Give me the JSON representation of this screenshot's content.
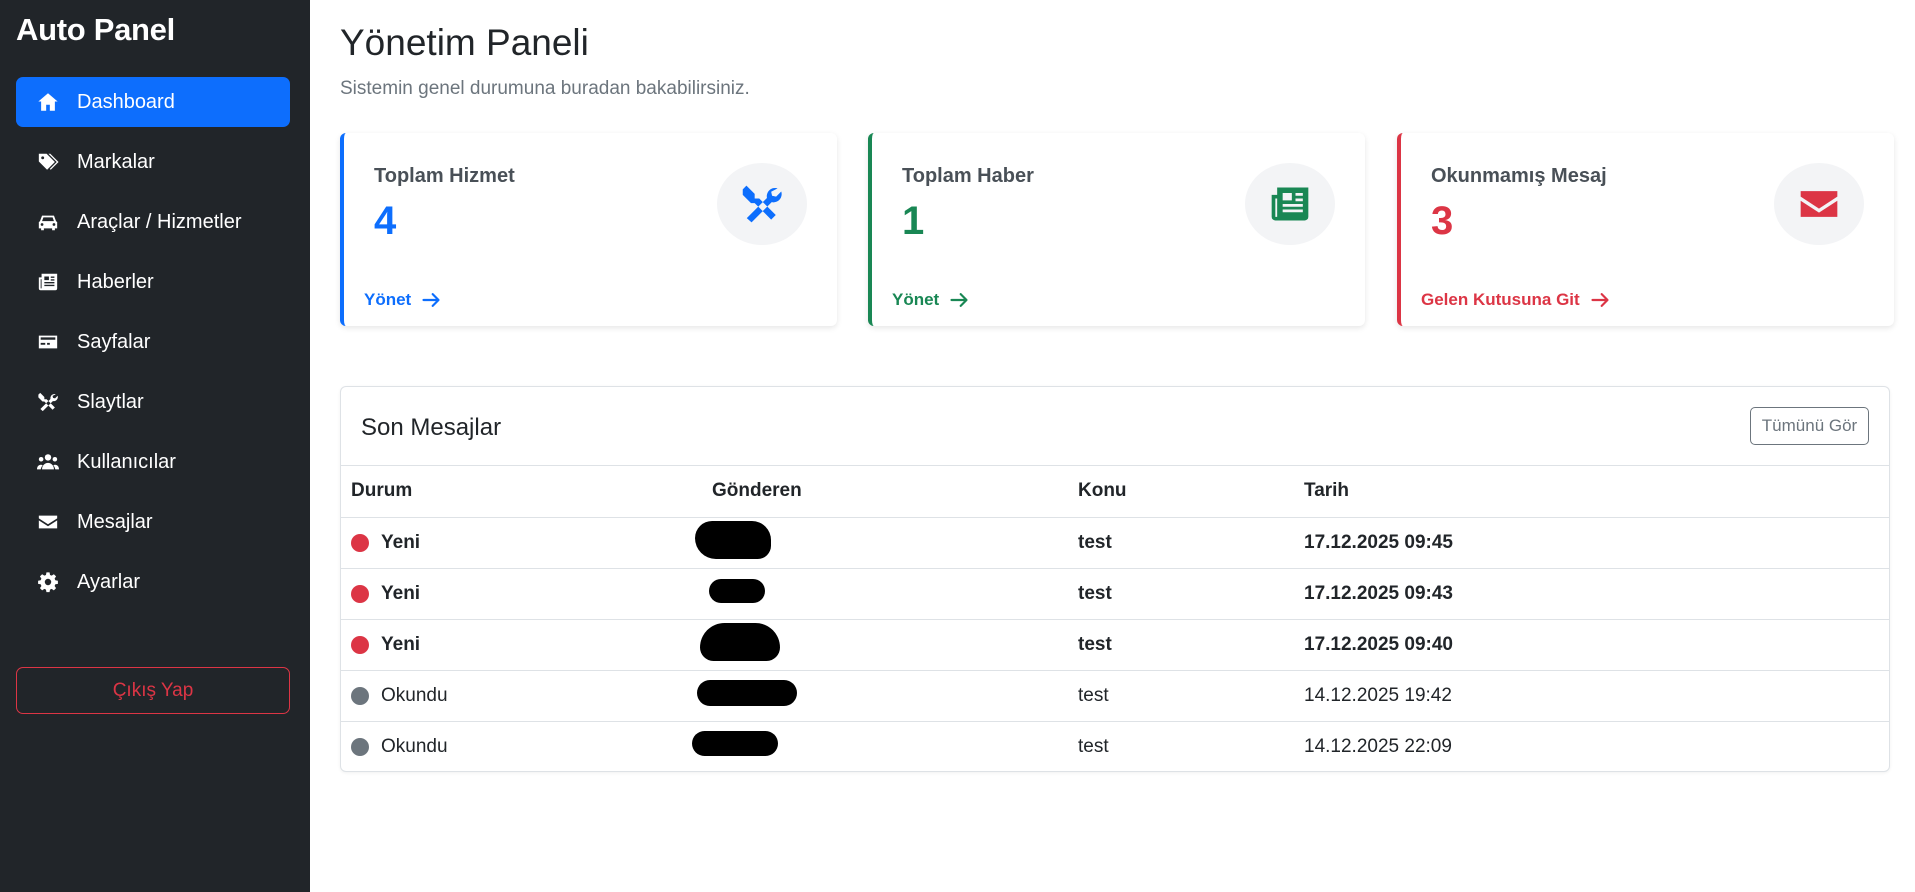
{
  "sidebar": {
    "brand": "Auto Panel",
    "items": [
      {
        "label": "Dashboard",
        "icon": "home-icon",
        "active": true
      },
      {
        "label": "Markalar",
        "icon": "tags-icon",
        "active": false
      },
      {
        "label": "Araçlar / Hizmetler",
        "icon": "car-icon",
        "active": false
      },
      {
        "label": "Haberler",
        "icon": "newspaper-icon",
        "active": false
      },
      {
        "label": "Sayfalar",
        "icon": "page-card-icon",
        "active": false
      },
      {
        "label": "Slaytlar",
        "icon": "tools-icon",
        "active": false
      },
      {
        "label": "Kullanıcılar",
        "icon": "users-icon",
        "active": false
      },
      {
        "label": "Mesajlar",
        "icon": "envelope-icon",
        "active": false
      },
      {
        "label": "Ayarlar",
        "icon": "gear-icon",
        "active": false
      }
    ],
    "logout_label": "Çıkış Yap"
  },
  "header": {
    "title": "Yönetim Paneli",
    "subtitle": "Sistemin genel durumuna buradan bakabilirsiniz."
  },
  "stats": [
    {
      "label": "Toplam Hizmet",
      "value": "4",
      "link": "Yönet",
      "icon": "tools-icon",
      "color": "#0d6efd"
    },
    {
      "label": "Toplam Haber",
      "value": "1",
      "link": "Yönet",
      "icon": "newspaper-icon",
      "color": "#198754"
    },
    {
      "label": "Okunmamış Mesaj",
      "value": "3",
      "link": "Gelen Kutusuna Git",
      "icon": "envelope-icon",
      "color": "#dc3545"
    }
  ],
  "messages": {
    "title": "Son Mesajlar",
    "view_all_label": "Tümünü Gör",
    "columns": [
      "Durum",
      "Gönderen",
      "Konu",
      "Tarih"
    ],
    "rows": [
      {
        "status": "Yeni",
        "unread": true,
        "subject": "test",
        "date": "17.12.2025 09:45"
      },
      {
        "status": "Yeni",
        "unread": true,
        "subject": "test",
        "date": "17.12.2025 09:43"
      },
      {
        "status": "Yeni",
        "unread": true,
        "subject": "test",
        "date": "17.12.2025 09:40"
      },
      {
        "status": "Okundu",
        "unread": false,
        "subject": "test",
        "date": "14.12.2025 19:42"
      },
      {
        "status": "Okundu",
        "unread": false,
        "subject": "test",
        "date": "14.12.2025 22:09"
      }
    ]
  },
  "colors": {
    "sidebar_bg": "#212529",
    "primary": "#0d6efd",
    "success": "#198754",
    "danger": "#dc3545",
    "muted": "#6c757d"
  }
}
